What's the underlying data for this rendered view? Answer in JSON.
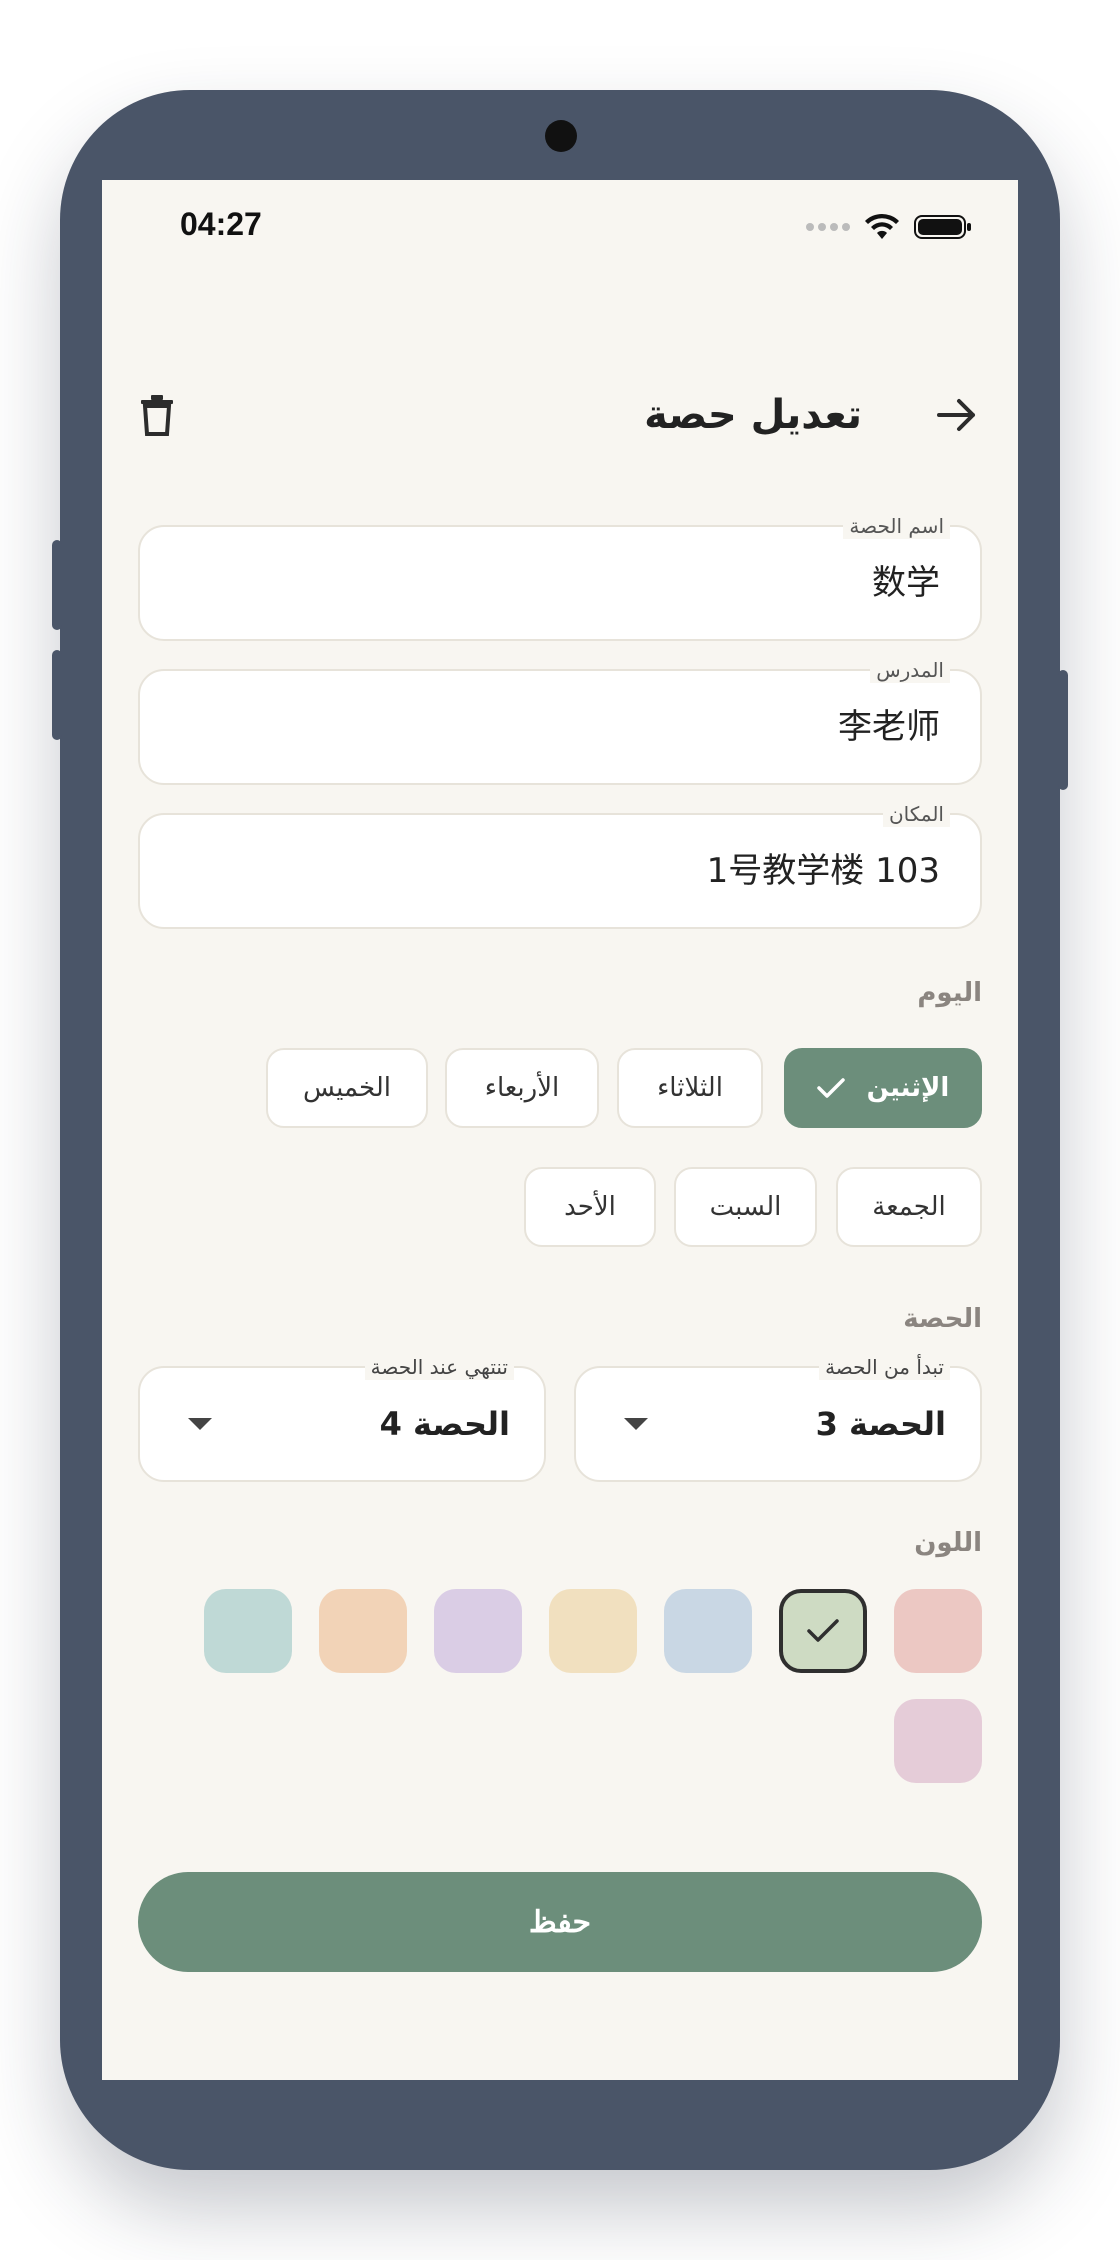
{
  "status_bar": {
    "time": "04:27"
  },
  "header": {
    "title": "تعديل حصة"
  },
  "form": {
    "name_label": "اسم الحصة",
    "name_value": "数学",
    "teacher_label": "المدرس",
    "teacher_value": "李老师",
    "location_label": "المكان",
    "location_value": "1号教学楼 103"
  },
  "day": {
    "label": "اليوم",
    "items": [
      "الإثنين",
      "الثلاثاء",
      "الأربعاء",
      "الخميس",
      "الجمعة",
      "السبت",
      "الأحد"
    ],
    "selected": "الإثنين"
  },
  "period": {
    "label": "الحصة",
    "start_label": "تبدأ من الحصة",
    "start_value": "الحصة 3",
    "end_label": "تنتهي عند الحصة",
    "end_value": "الحصة 4"
  },
  "color": {
    "label": "اللون",
    "swatches": [
      "#ecc8c3",
      "#cedbc3",
      "#c9d7e4",
      "#f1e0bf",
      "#dacde5",
      "#f2d3b7",
      "#bfd9d6",
      "#e5ccd8"
    ],
    "selected_index": 1
  },
  "save_label": "حفظ"
}
